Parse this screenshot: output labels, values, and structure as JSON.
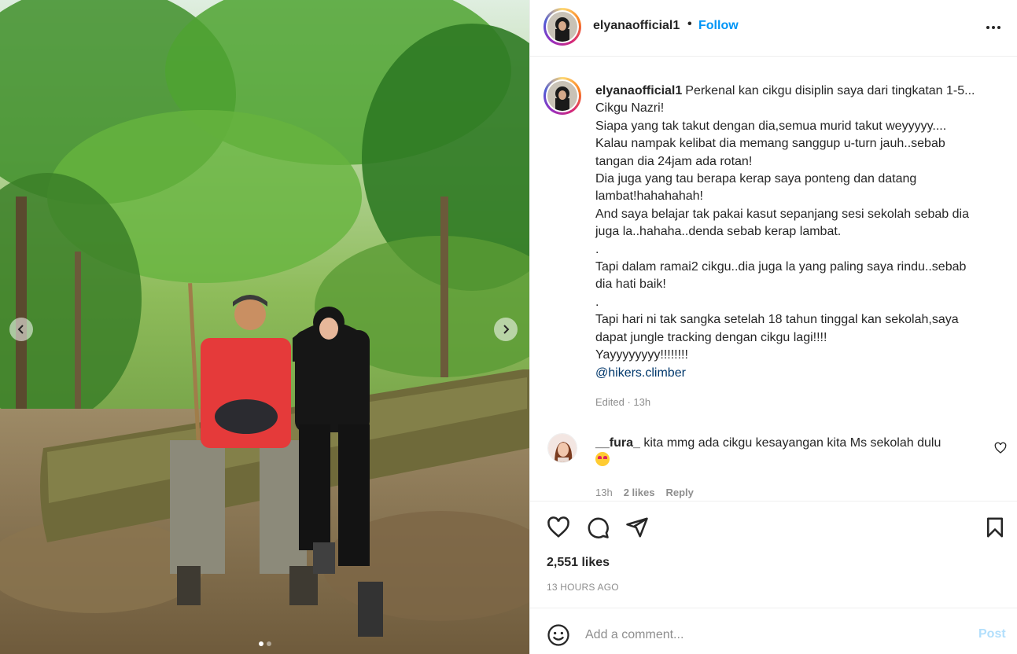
{
  "post": {
    "image_alt": "",
    "carousel_dots": 2,
    "active_dot": 0
  },
  "header": {
    "username": "elyanaofficial1",
    "separator": "•",
    "follow_label": "Follow"
  },
  "caption": {
    "username": "elyanaofficial1",
    "lines": [
      "Perkenal kan cikgu disiplin saya dari tingkatan 1-5...",
      "Cikgu Nazri!",
      "Siapa yang tak takut dengan dia,semua murid takut weyyyyy....",
      "Kalau nampak kelibat dia memang sanggup u-turn jauh..sebab",
      "tangan dia 24jam ada rotan!",
      "Dia juga yang tau berapa kerap saya ponteng dan datang",
      "lambat!hahahahah!",
      "And saya belajar tak pakai kasut sepanjang sesi sekolah sebab dia",
      "juga la..hahaha..denda sebab kerap lambat.",
      ".",
      "Tapi dalam ramai2 cikgu..dia juga la yang paling saya rindu..sebab",
      "dia hati baik!",
      ".",
      "Tapi hari ni tak sangka setelah 18 tahun tinggal kan sekolah,saya",
      "dapat jungle tracking dengan cikgu lagi!!!!",
      "Yayyyyyyyy!!!!!!!!"
    ],
    "mention": "@hikers.climber",
    "edited": "Edited · 13h"
  },
  "comment": {
    "username": "__fura_",
    "text": "kita mmg ada cikgu kesayangan kita Ms sekolah dulu",
    "time": "13h",
    "likes": "2 likes",
    "reply": "Reply"
  },
  "stats": {
    "likes": "2,551 likes",
    "posted": "13 HOURS AGO"
  },
  "add_comment": {
    "placeholder": "Add a comment...",
    "post_label": "Post"
  },
  "colors": {
    "accent": "#0095f6",
    "post_disabled": "#b2dffc",
    "mention": "#00376b",
    "muted": "#8e8e8e"
  }
}
